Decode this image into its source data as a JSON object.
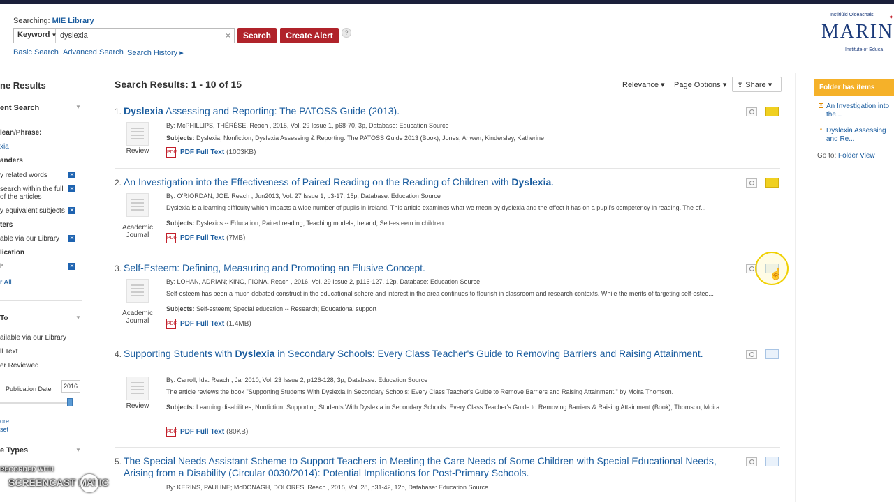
{
  "header": {
    "searching_label": "Searching:",
    "database": "MIE Library",
    "search_type": "Keyword",
    "search_value": "dyslexia",
    "clear_symbol": "×",
    "search_button": "Search",
    "alert_button": "Create Alert",
    "help_symbol": "?",
    "links": [
      "Basic Search",
      "Advanced Search",
      "Search History ▸"
    ]
  },
  "logo": {
    "line1": "Institiúid Oideachais",
    "main": "MARINO",
    "line3": "Institute of Educa"
  },
  "sidebar": {
    "title": "ne Results",
    "current_search": "ent Search",
    "boolean_label": "lean/Phrase:",
    "boolean_value": "xia",
    "expanders": "anders",
    "expander_items": [
      "y related words",
      "search within the full",
      "of the articles",
      "y equivalent subjects"
    ],
    "limiters": "ters",
    "limiter_items": [
      "able via our Library"
    ],
    "publication": "lication",
    "pub_item": "h",
    "clear_all": "r All",
    "limit_to": "To",
    "limit_items": [
      "ailable via our Library",
      "ll Text",
      "er Reviewed"
    ],
    "pub_date_label": "Publication Date",
    "pub_date_value": "2016",
    "show_more": "ore",
    "reset": "set",
    "source_types": "e Types"
  },
  "watermark": {
    "line1": "RECORDED WITH",
    "line2": "SCREENCAST MATIC"
  },
  "results_header": {
    "title": "Search Results: 1 - 10 of 15",
    "relevance": "Relevance ▾",
    "page_options": "Page Options ▾",
    "share": "Share ▾"
  },
  "results": [
    {
      "num": "1.",
      "title_parts": [
        "Dyslexia",
        " Assessing and Reporting: The PATOSS Guide (2013)."
      ],
      "type": "Review",
      "meta": "By: McPHILLIPS, THÉRÈSE. Reach , 2015, Vol. 29 Issue 1, p68-70, 3p, Database: Education Source",
      "abstract": "",
      "subjects_label": "Subjects:",
      "subjects": "Dyslexia; Nonfiction; Dyslexia Assessing & Reporting: The PATOSS Guide 2013 (Book); Jones, Anwen; Kindersley, Katherine",
      "pdf_label": "PDF Full Text",
      "pdf_size": "(1003KB)",
      "in_folder": true
    },
    {
      "num": "2.",
      "title_parts": [
        "An Investigation into the Effectiveness of Paired Reading on the Reading of Children with ",
        "Dyslexia",
        "."
      ],
      "type": "Academic Journal",
      "meta": "By: O'RIORDAN, JOE. Reach , Jun2013, Vol. 27 Issue 1, p3-17, 15p, Database: Education Source",
      "abstract": "Dyslexia is a learning difficulty which impacts a wide number of pupils in Ireland. This article examines what we mean by dyslexia and the effect it has on a pupil's competency in reading. The ef...",
      "subjects_label": "Subjects:",
      "subjects": "Dyslexics -- Education; Paired reading; Teaching models; Ireland; Self-esteem in children",
      "pdf_label": "PDF Full Text",
      "pdf_size": "(7MB)",
      "in_folder": true
    },
    {
      "num": "3.",
      "title_parts": [
        "Self-Esteem: Defining, Measuring and Promoting an Elusive Concept."
      ],
      "type": "Academic Journal",
      "meta": "By: LOHAN, ADRIAN; KING, FIONA. Reach , 2016, Vol. 29 Issue 2, p116-127, 12p, Database: Education Source",
      "abstract": "Self-esteem has been a much debated construct in the educational sphere and interest in the area continues to flourish in classroom and research contexts. While the merits of targeting self-estee...",
      "subjects_label": "Subjects:",
      "subjects": "Self-esteem; Special education -- Research; Educational support",
      "pdf_label": "PDF Full Text",
      "pdf_size": "(1.4MB)",
      "in_folder": false
    },
    {
      "num": "4.",
      "title_parts": [
        "Supporting Students with ",
        "Dyslexia",
        " in Secondary Schools: Every Class Teacher's Guide to Removing Barriers and Raising Attainment."
      ],
      "type": "Review",
      "meta": "By: Carroll, Ida. Reach , Jan2010, Vol. 23 Issue 2, p126-128, 3p, Database: Education Source",
      "abstract": "The article reviews the book \"Supporting Students With Dyslexia in Secondary Schools: Every Class Teacher's Guide to Remove Barriers and Raising Attainment,\" by Moira Thomson.",
      "subjects_label": "Subjects:",
      "subjects": "Learning disabilities; Nonfiction; Supporting Students With Dyslexia in Secondary Schools: Every Class Teacher's Guide to Removing Barriers & Raising Attainment (Book); Thomson, Moira",
      "pdf_label": "PDF Full Text",
      "pdf_size": "(80KB)",
      "in_folder": false
    },
    {
      "num": "5.",
      "title_parts": [
        "The Special Needs Assistant Scheme to Support Teachers in Meeting the Care Needs of Some Children with Special Educational Needs, Arising from a Disability (Circular 0030/2014): Potential Implications for Post-Primary Schools."
      ],
      "type": "",
      "meta": "By: KERINS, PAULINE; McDONAGH, DOLORES. Reach , 2015, Vol. 28, p31-42, 12p, Database: Education Source",
      "abstract": "",
      "subjects_label": "",
      "subjects": "",
      "pdf_label": "",
      "pdf_size": "",
      "in_folder": false
    }
  ],
  "folder": {
    "header": "Folder has items",
    "items": [
      "An Investigation into the...",
      "Dyslexia Assessing and Re..."
    ],
    "goto_label": "Go to:",
    "goto_link": "Folder View"
  },
  "colors": {
    "accent_red": "#b0232a",
    "link_blue": "#1a5c9e",
    "folder_orange": "#f5b129",
    "folder_yellow": "#f0d020"
  }
}
